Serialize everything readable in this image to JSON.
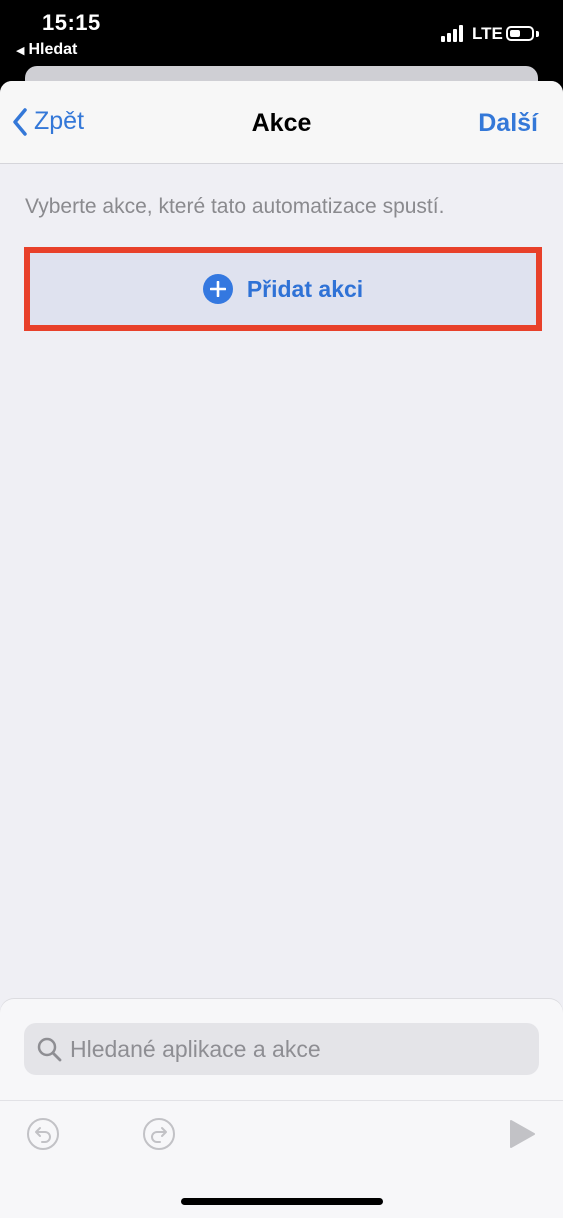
{
  "status_bar": {
    "time": "15:15",
    "back_app": "Hledat",
    "network": "LTE"
  },
  "nav": {
    "back_label": "Zpět",
    "title": "Akce",
    "next_label": "Další"
  },
  "content": {
    "hint": "Vyberte akce, které tato automatizace spustí.",
    "add_action_label": "Přidat akci"
  },
  "search": {
    "placeholder": "Hledané aplikace a akce"
  },
  "toolbar": {
    "icons": [
      "undo-icon",
      "redo-icon",
      "play-icon"
    ]
  },
  "colors": {
    "accent": "#3478d8",
    "highlight": "#e8402a",
    "background": "#efeff4"
  }
}
